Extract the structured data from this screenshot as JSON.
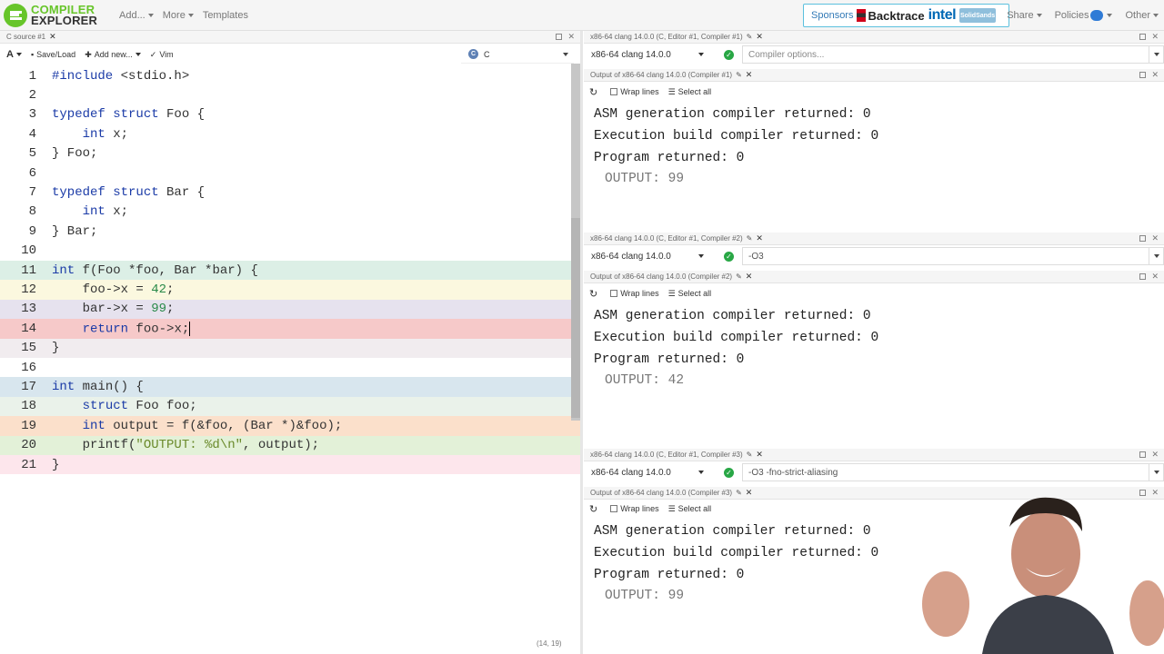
{
  "navbar": {
    "logo_line1": "COMPILER",
    "logo_line2": "EXPLORER",
    "menu": [
      "Add...",
      "More",
      "Templates"
    ],
    "sponsors_label": "Sponsors",
    "sponsor_backtrace": "Backtrace",
    "sponsor_intel": "intel",
    "sponsor_ss": "SolidSands",
    "right_menu": [
      "Share",
      "Policies",
      "Other"
    ]
  },
  "editor": {
    "tab_title": "C source #1",
    "toolbar": {
      "font_btn": "A",
      "save_load": "Save/Load",
      "add_new": "Add new...",
      "vim": "Vim"
    },
    "language": "C",
    "cursor_position": "(14, 19)",
    "line_numbers": [
      "1",
      "2",
      "3",
      "4",
      "5",
      "6",
      "7",
      "8",
      "9",
      "10",
      "11",
      "12",
      "13",
      "14",
      "15",
      "16",
      "17",
      "18",
      "19",
      "20",
      "21"
    ]
  },
  "compilers": [
    {
      "tab_title": "x86-64 clang 14.0.0 (C, Editor #1, Compiler #1)",
      "compiler_name": "x86-64 clang 14.0.0",
      "options_placeholder": "Compiler options...",
      "options": "",
      "output_tab_title": "Output of x86-64 clang 14.0.0 (Compiler #1)",
      "wrap_lines": "Wrap lines",
      "select_all": "Select all",
      "output_lines": [
        "ASM generation compiler returned: 0",
        "Execution build compiler returned: 0",
        "Program returned: 0"
      ],
      "program_output": "OUTPUT: 99"
    },
    {
      "tab_title": "x86-64 clang 14.0.0 (C, Editor #1, Compiler #2)",
      "compiler_name": "x86-64 clang 14.0.0",
      "options": "-O3",
      "output_tab_title": "Output of x86-64 clang 14.0.0 (Compiler #2)",
      "wrap_lines": "Wrap lines",
      "select_all": "Select all",
      "output_lines": [
        "ASM generation compiler returned: 0",
        "Execution build compiler returned: 0",
        "Program returned: 0"
      ],
      "program_output": "OUTPUT: 42"
    },
    {
      "tab_title": "x86-64 clang 14.0.0 (C, Editor #1, Compiler #3)",
      "compiler_name": "x86-64 clang 14.0.0",
      "options": "-O3 -fno-strict-aliasing",
      "output_tab_title": "Output of x86-64 clang 14.0.0 (Compiler #3)",
      "wrap_lines": "Wrap lines",
      "select_all": "Select all",
      "output_lines": [
        "ASM generation compiler returned: 0",
        "Execution build compiler returned: 0",
        "Program returned: 0"
      ],
      "program_output": "OUTPUT: 99"
    }
  ],
  "colors": {
    "brand_green": "#67c52a",
    "keyword_blue": "#1b3ba7",
    "line11_bg": "#dcefe6",
    "line12_bg": "#fbf8df",
    "line13_bg": "#e6e2ee",
    "line14_bg": "#f6c9c9",
    "line15_bg": "#f1ecef",
    "line17_bg": "#d8e6ee",
    "line18_bg": "#eaf2ea",
    "line19_bg": "#fbe0cb",
    "line20_bg": "#e3f1d8",
    "line21_bg": "#fde6ec",
    "ok_green": "#28a745"
  }
}
